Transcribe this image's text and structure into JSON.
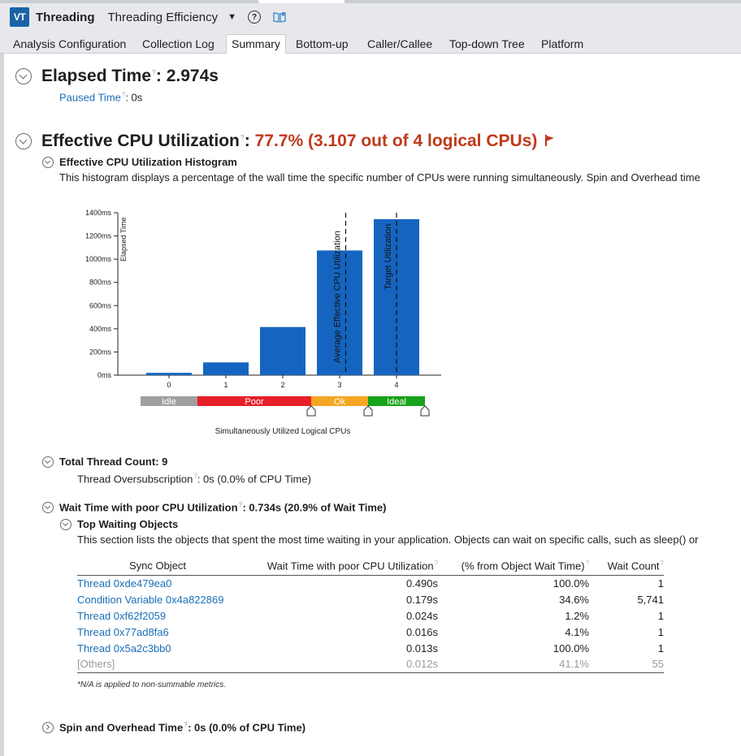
{
  "header": {
    "logo_text": "VT",
    "app_title": "Threading",
    "analysis_title": "Threading Efficiency",
    "caret": "▼",
    "help_glyph": "?"
  },
  "tabs": [
    {
      "label": "Analysis Configuration",
      "active": false
    },
    {
      "label": "Collection Log",
      "active": false
    },
    {
      "label": "Summary",
      "active": true
    },
    {
      "label": "Bottom-up",
      "active": false
    },
    {
      "label": "Caller/Callee",
      "active": false
    },
    {
      "label": "Top-down Tree",
      "active": false
    },
    {
      "label": "Platform",
      "active": false
    }
  ],
  "elapsed": {
    "label": "Elapsed Time",
    "value": ": 2.974s",
    "paused_label": "Paused Time",
    "paused_value": ":  0s"
  },
  "cpu_util": {
    "label": "Effective CPU Utilization",
    "colon": ": ",
    "value": "77.7% (3.107 out of 4 logical CPUs)",
    "flag_icon": "flag-icon"
  },
  "histogram_section": {
    "title": "Effective CPU Utilization Histogram",
    "description": "This histogram displays a percentage of the wall time the specific number of CPUs were running simultaneously. Spin and Overhead time"
  },
  "chart_data": {
    "type": "bar",
    "categories": [
      "0",
      "1",
      "2",
      "3",
      "4"
    ],
    "values": [
      20,
      110,
      415,
      1075,
      1345
    ],
    "ylabel": "Elapsed Time",
    "xlabel": "Simultaneously Utilized Logical CPUs",
    "yticks": [
      "0ms",
      "200ms",
      "400ms",
      "600ms",
      "800ms",
      "1000ms",
      "1200ms",
      "1400ms"
    ],
    "ylim": [
      0,
      1400
    ],
    "bar_color": "#1565c0",
    "markers": [
      {
        "label": "Average Effective CPU Utilization",
        "x": 3.107
      },
      {
        "label": "Target Utilization",
        "x": 4
      }
    ],
    "bands": [
      {
        "label": "Idle",
        "color": "#a0a0a0"
      },
      {
        "label": "Poor",
        "color": "#e8202a"
      },
      {
        "label": "Ok",
        "color": "#f5a623"
      },
      {
        "label": "Ideal",
        "color": "#17a31a"
      }
    ]
  },
  "thread_count": {
    "title": "Total Thread Count: 9",
    "oversub_label": "Thread Oversubscription",
    "oversub_value": ":  0s (0.0% of CPU Time)"
  },
  "wait_time": {
    "label": "Wait Time with poor CPU Utilization",
    "value": ": 0.734s (20.9% of Wait Time)",
    "top_title": "Top Waiting Objects",
    "description": "This section lists the objects that spent the most time waiting in your application. Objects can wait on specific calls, such as sleep() or",
    "columns": [
      "Sync Object",
      "Wait Time with poor CPU Utilization",
      "(% from Object Wait Time)",
      "Wait Count"
    ],
    "rows": [
      [
        "Thread 0xde479ea0",
        "0.490s",
        "100.0%",
        "1"
      ],
      [
        "Condition Variable 0x4a822869",
        "0.179s",
        "34.6%",
        "5,741"
      ],
      [
        "Thread 0xf62f2059",
        "0.024s",
        "1.2%",
        "1"
      ],
      [
        "Thread 0x77ad8fa6",
        "0.016s",
        "4.1%",
        "1"
      ],
      [
        "Thread 0x5a2c3bb0",
        "0.013s",
        "100.0%",
        "1"
      ],
      [
        "[Others]",
        "0.012s",
        "41.1%",
        "55"
      ]
    ],
    "footnote": "*N/A is applied to non-summable metrics."
  },
  "spin": {
    "label": "Spin and Overhead Time",
    "value": ": 0s (0.0% of CPU Time)"
  }
}
